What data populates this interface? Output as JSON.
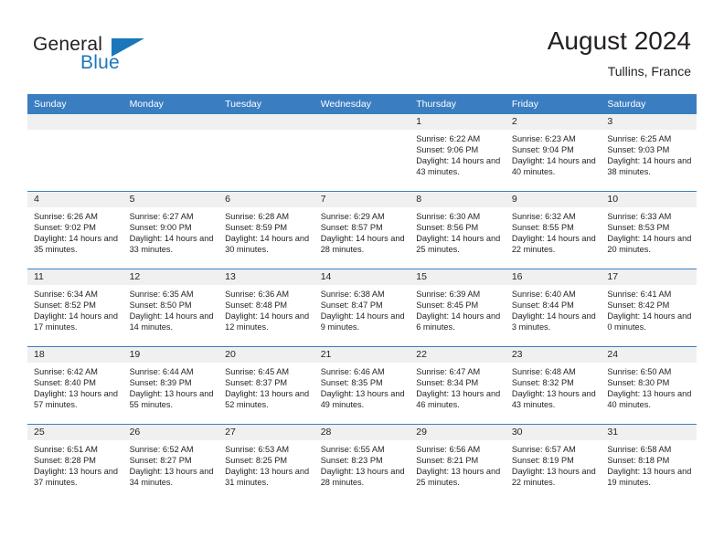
{
  "brand": {
    "word_one": "General",
    "word_two": "Blue",
    "triangle_color": "#1b76bc"
  },
  "header": {
    "title": "August 2024",
    "subtitle": "Tullins, France"
  },
  "theme": {
    "header_blue": "#3a7ec1",
    "day_band_gray": "#f0f0f0",
    "text_color": "#231f20"
  },
  "weekday_headers": [
    "Sunday",
    "Monday",
    "Tuesday",
    "Wednesday",
    "Thursday",
    "Friday",
    "Saturday"
  ],
  "labels": {
    "sunrise_prefix": "Sunrise:",
    "sunset_prefix": "Sunset:",
    "daylight_prefix": "Daylight:"
  },
  "weeks": [
    [
      {
        "day": "",
        "empty": true
      },
      {
        "day": "",
        "empty": true
      },
      {
        "day": "",
        "empty": true
      },
      {
        "day": "",
        "empty": true
      },
      {
        "day": "1",
        "sunrise": "Sunrise: 6:22 AM",
        "sunset": "Sunset: 9:06 PM",
        "daylight": "Daylight: 14 hours and 43 minutes."
      },
      {
        "day": "2",
        "sunrise": "Sunrise: 6:23 AM",
        "sunset": "Sunset: 9:04 PM",
        "daylight": "Daylight: 14 hours and 40 minutes."
      },
      {
        "day": "3",
        "sunrise": "Sunrise: 6:25 AM",
        "sunset": "Sunset: 9:03 PM",
        "daylight": "Daylight: 14 hours and 38 minutes."
      }
    ],
    [
      {
        "day": "4",
        "sunrise": "Sunrise: 6:26 AM",
        "sunset": "Sunset: 9:02 PM",
        "daylight": "Daylight: 14 hours and 35 minutes."
      },
      {
        "day": "5",
        "sunrise": "Sunrise: 6:27 AM",
        "sunset": "Sunset: 9:00 PM",
        "daylight": "Daylight: 14 hours and 33 minutes."
      },
      {
        "day": "6",
        "sunrise": "Sunrise: 6:28 AM",
        "sunset": "Sunset: 8:59 PM",
        "daylight": "Daylight: 14 hours and 30 minutes."
      },
      {
        "day": "7",
        "sunrise": "Sunrise: 6:29 AM",
        "sunset": "Sunset: 8:57 PM",
        "daylight": "Daylight: 14 hours and 28 minutes."
      },
      {
        "day": "8",
        "sunrise": "Sunrise: 6:30 AM",
        "sunset": "Sunset: 8:56 PM",
        "daylight": "Daylight: 14 hours and 25 minutes."
      },
      {
        "day": "9",
        "sunrise": "Sunrise: 6:32 AM",
        "sunset": "Sunset: 8:55 PM",
        "daylight": "Daylight: 14 hours and 22 minutes."
      },
      {
        "day": "10",
        "sunrise": "Sunrise: 6:33 AM",
        "sunset": "Sunset: 8:53 PM",
        "daylight": "Daylight: 14 hours and 20 minutes."
      }
    ],
    [
      {
        "day": "11",
        "sunrise": "Sunrise: 6:34 AM",
        "sunset": "Sunset: 8:52 PM",
        "daylight": "Daylight: 14 hours and 17 minutes."
      },
      {
        "day": "12",
        "sunrise": "Sunrise: 6:35 AM",
        "sunset": "Sunset: 8:50 PM",
        "daylight": "Daylight: 14 hours and 14 minutes."
      },
      {
        "day": "13",
        "sunrise": "Sunrise: 6:36 AM",
        "sunset": "Sunset: 8:48 PM",
        "daylight": "Daylight: 14 hours and 12 minutes."
      },
      {
        "day": "14",
        "sunrise": "Sunrise: 6:38 AM",
        "sunset": "Sunset: 8:47 PM",
        "daylight": "Daylight: 14 hours and 9 minutes."
      },
      {
        "day": "15",
        "sunrise": "Sunrise: 6:39 AM",
        "sunset": "Sunset: 8:45 PM",
        "daylight": "Daylight: 14 hours and 6 minutes."
      },
      {
        "day": "16",
        "sunrise": "Sunrise: 6:40 AM",
        "sunset": "Sunset: 8:44 PM",
        "daylight": "Daylight: 14 hours and 3 minutes."
      },
      {
        "day": "17",
        "sunrise": "Sunrise: 6:41 AM",
        "sunset": "Sunset: 8:42 PM",
        "daylight": "Daylight: 14 hours and 0 minutes."
      }
    ],
    [
      {
        "day": "18",
        "sunrise": "Sunrise: 6:42 AM",
        "sunset": "Sunset: 8:40 PM",
        "daylight": "Daylight: 13 hours and 57 minutes."
      },
      {
        "day": "19",
        "sunrise": "Sunrise: 6:44 AM",
        "sunset": "Sunset: 8:39 PM",
        "daylight": "Daylight: 13 hours and 55 minutes."
      },
      {
        "day": "20",
        "sunrise": "Sunrise: 6:45 AM",
        "sunset": "Sunset: 8:37 PM",
        "daylight": "Daylight: 13 hours and 52 minutes."
      },
      {
        "day": "21",
        "sunrise": "Sunrise: 6:46 AM",
        "sunset": "Sunset: 8:35 PM",
        "daylight": "Daylight: 13 hours and 49 minutes."
      },
      {
        "day": "22",
        "sunrise": "Sunrise: 6:47 AM",
        "sunset": "Sunset: 8:34 PM",
        "daylight": "Daylight: 13 hours and 46 minutes."
      },
      {
        "day": "23",
        "sunrise": "Sunrise: 6:48 AM",
        "sunset": "Sunset: 8:32 PM",
        "daylight": "Daylight: 13 hours and 43 minutes."
      },
      {
        "day": "24",
        "sunrise": "Sunrise: 6:50 AM",
        "sunset": "Sunset: 8:30 PM",
        "daylight": "Daylight: 13 hours and 40 minutes."
      }
    ],
    [
      {
        "day": "25",
        "sunrise": "Sunrise: 6:51 AM",
        "sunset": "Sunset: 8:28 PM",
        "daylight": "Daylight: 13 hours and 37 minutes."
      },
      {
        "day": "26",
        "sunrise": "Sunrise: 6:52 AM",
        "sunset": "Sunset: 8:27 PM",
        "daylight": "Daylight: 13 hours and 34 minutes."
      },
      {
        "day": "27",
        "sunrise": "Sunrise: 6:53 AM",
        "sunset": "Sunset: 8:25 PM",
        "daylight": "Daylight: 13 hours and 31 minutes."
      },
      {
        "day": "28",
        "sunrise": "Sunrise: 6:55 AM",
        "sunset": "Sunset: 8:23 PM",
        "daylight": "Daylight: 13 hours and 28 minutes."
      },
      {
        "day": "29",
        "sunrise": "Sunrise: 6:56 AM",
        "sunset": "Sunset: 8:21 PM",
        "daylight": "Daylight: 13 hours and 25 minutes."
      },
      {
        "day": "30",
        "sunrise": "Sunrise: 6:57 AM",
        "sunset": "Sunset: 8:19 PM",
        "daylight": "Daylight: 13 hours and 22 minutes."
      },
      {
        "day": "31",
        "sunrise": "Sunrise: 6:58 AM",
        "sunset": "Sunset: 8:18 PM",
        "daylight": "Daylight: 13 hours and 19 minutes."
      }
    ]
  ]
}
